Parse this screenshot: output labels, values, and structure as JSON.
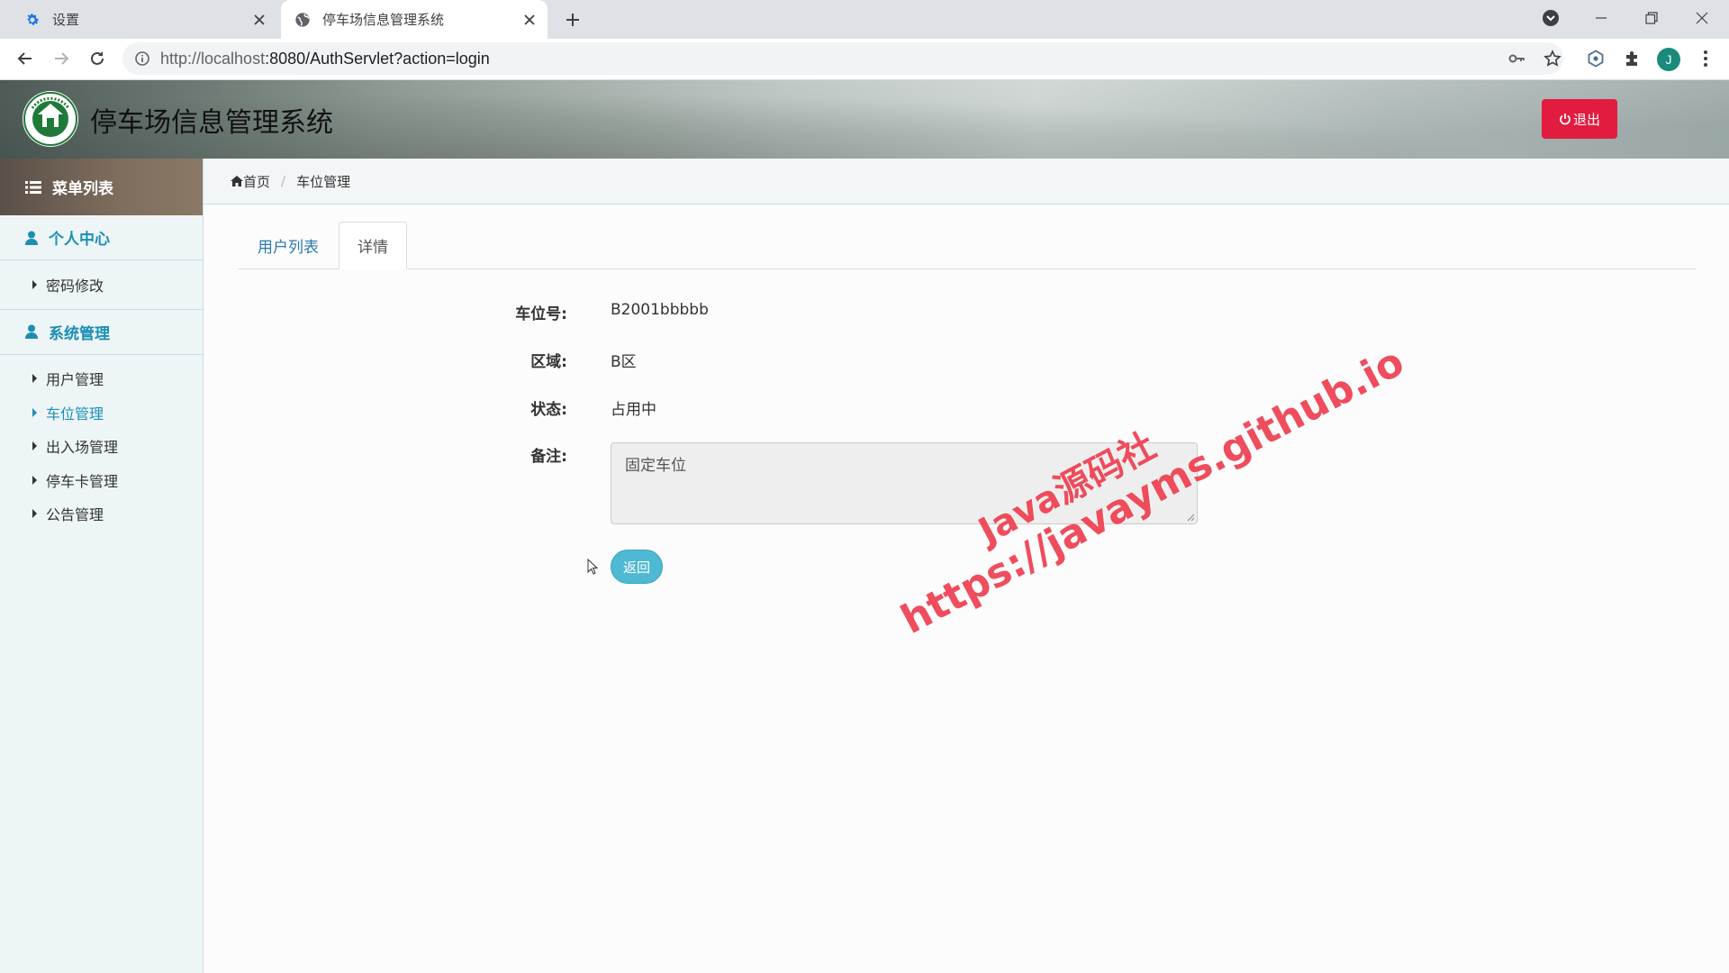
{
  "browser": {
    "tabs": [
      {
        "title": "设置",
        "icon": "gear-icon",
        "active": false
      },
      {
        "title": "停车场信息管理系统",
        "icon": "globe-icon",
        "active": true
      }
    ],
    "url_host": "http://localhost",
    "url_rest": ":8080/AuthServlet?action=login",
    "profile_initial": "J"
  },
  "app": {
    "title": "停车场信息管理系统",
    "logout_label": "退出"
  },
  "sidebar": {
    "header": "菜单列表",
    "groups": [
      {
        "title": "个人中心",
        "items": [
          {
            "label": "密码修改",
            "active": false
          }
        ]
      },
      {
        "title": "系统管理",
        "items": [
          {
            "label": "用户管理",
            "active": false
          },
          {
            "label": "车位管理",
            "active": true
          },
          {
            "label": "出入场管理",
            "active": false
          },
          {
            "label": "停车卡管理",
            "active": false
          },
          {
            "label": "公告管理",
            "active": false
          }
        ]
      }
    ]
  },
  "breadcrumb": {
    "home": "首页",
    "current": "车位管理"
  },
  "page_tabs": {
    "list": "用户列表",
    "detail": "详情"
  },
  "detail": {
    "space_no_label": "车位号:",
    "space_no_value": "B2001bbbbb",
    "area_label": "区域:",
    "area_value": "B区",
    "status_label": "状态:",
    "status_value": "占用中",
    "remark_label": "备注:",
    "remark_value": "固定车位",
    "back_label": "返回"
  },
  "watermark": {
    "line1": "Java源码社",
    "line2": "https://javayms.github.io"
  },
  "colors": {
    "accent": "#1a8fb4",
    "logout": "#e21c3f",
    "back_button": "#4fb8d2",
    "watermark": "#ee3b4c"
  }
}
